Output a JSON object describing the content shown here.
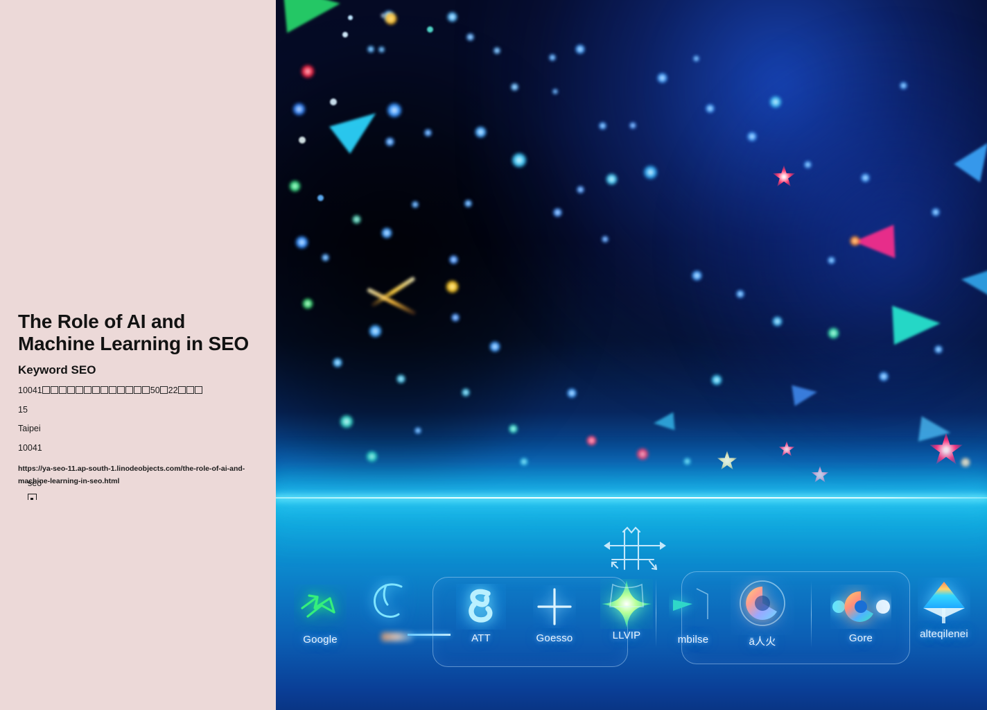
{
  "article": {
    "title_line1": "The Role of AI and",
    "title_line2": "Machine Learning in SEO",
    "keyword_heading": "Keyword SEO",
    "address_prefix": "10041",
    "address_boxes_1": 13,
    "address_mid1": "50",
    "address_boxes_2": 1,
    "address_mid2": "22",
    "address_boxes_3": 3,
    "address_full": "10041□□□□□□□□□□□□□50□22□□□",
    "number": "15",
    "city": "Taipei",
    "postal_code": "10041",
    "url": "https://ya-seo-11.ap-south-1.linodeobjects.com/the-role-of-ai-and-machine-learning-in-seo.html",
    "tag": "seo"
  },
  "colors": {
    "panel_background": "#ecd9d8",
    "text": "#141414",
    "hero_horizon": "#17cdec",
    "hero_sky_top": "#050a24",
    "hero_sky_bottom": "#093585",
    "dock_label": "#eaf4ff"
  },
  "hero": {
    "alt": "Abstract blue digital space with glowing particles and AI search engine icons",
    "hud_glyph_name": "grid-arrows-hud-glyph"
  },
  "dock": {
    "items": [
      {
        "label": "Google",
        "icon": "green-arrow-burst-icon"
      },
      {
        "label": "",
        "icon": "neon-c-loop-icon"
      },
      {
        "label": "ATT",
        "icon": "cyan-spiral-icon"
      },
      {
        "label": "Goesso",
        "icon": "plus-cross-icon"
      },
      {
        "label": "LLVIP",
        "icon": "green-four-point-star-icon"
      },
      {
        "label": "mbilse",
        "icon": "teal-chevron-icon"
      },
      {
        "label": "ā人火",
        "icon": "chrome-ring-icon"
      },
      {
        "label": "Gore",
        "icon": "multicolor-orbit-icon"
      },
      {
        "label": "alteqilenei",
        "icon": "gradient-cone-icon"
      }
    ]
  }
}
